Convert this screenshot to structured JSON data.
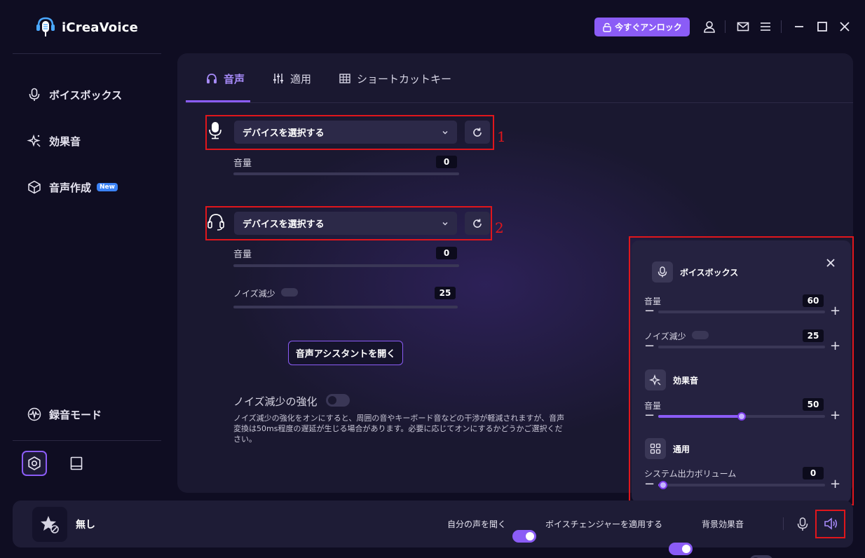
{
  "app": {
    "title": "iCreaVoice",
    "unlock_label": "今すぐアンロック"
  },
  "sidebar": {
    "items": [
      {
        "label": "ボイスボックス",
        "icon": "mic-icon"
      },
      {
        "label": "効果音",
        "icon": "sparkle-icon"
      },
      {
        "label": "音声作成",
        "icon": "cube-icon",
        "badge": "New"
      }
    ],
    "record_mode_label": "録音モード"
  },
  "tabs": [
    {
      "label": "音声",
      "icon": "headphones-icon"
    },
    {
      "label": "適用",
      "icon": "sliders-icon"
    },
    {
      "label": "ショートカットキー",
      "icon": "grid-icon"
    }
  ],
  "input_device": {
    "placeholder": "デバイスを選択する",
    "volume_label": "音量",
    "volume_value": "0",
    "annotation": "1"
  },
  "output_device": {
    "placeholder": "デバイスを選択する",
    "volume_label": "音量",
    "volume_value": "0",
    "noise_label": "ノイズ減少",
    "noise_value": "25",
    "annotation": "2"
  },
  "assistant_button": "音声アシスタントを開く",
  "noise_enhance": {
    "title": "ノイズ減少の強化",
    "description": "ノイズ減少の強化をオンにすると、周囲の音やキーボード音などの干渉が軽減されますが、音声変換は50ms程度の遅延が生じる場合があります。必要に応じてオンにするかどうかご選択ください。"
  },
  "popover": {
    "voicebox_title": "ボイスボックス",
    "voicebox_volume_label": "音量",
    "voicebox_volume_value": "60",
    "voicebox_noise_label": "ノイズ減少",
    "voicebox_noise_value": "25",
    "effects_title": "効果音",
    "effects_volume_label": "音量",
    "effects_volume_value": "50",
    "effects_volume_fraction": 0.5,
    "general_title": "通用",
    "system_volume_label": "システム出力ボリューム",
    "system_volume_value": "0",
    "system_volume_fraction": 0.03
  },
  "bottom_bar": {
    "current_effect": "無し",
    "hear_self_label": "自分の声を聞く",
    "apply_voice_label": "ボイスチェンジャーを適用する",
    "bg_effect_label": "背景効果音"
  },
  "colors": {
    "accent": "#8b5cf6",
    "annotation_red": "#e0161c",
    "background": "#0f0d22",
    "panel": "#1a1830"
  }
}
